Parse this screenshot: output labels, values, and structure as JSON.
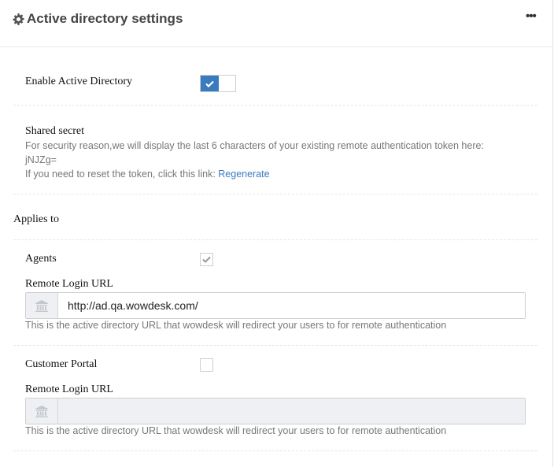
{
  "header": {
    "title": "Active directory settings",
    "menu_label": "•••"
  },
  "enable": {
    "label": "Enable Active Directory",
    "enabled": true
  },
  "shared_secret": {
    "label": "Shared secret",
    "description": "For security reason,we will display the last 6 characters of your existing remote authentication token here:",
    "token": "jNJZg=",
    "reset_text": "If you need to reset the token, click this link: ",
    "reset_link": "Regenerate"
  },
  "applies_to": {
    "label": "Applies to"
  },
  "agents": {
    "label": "Agents",
    "checked": true,
    "url_label": "Remote Login URL",
    "url_value": "http://ad.qa.wowdesk.com/",
    "help": "This is the active directory URL that wowdesk will redirect your users to for remote authentication"
  },
  "customer_portal": {
    "label": "Customer Portal",
    "checked": false,
    "url_label": "Remote Login URL",
    "url_value": "",
    "help": "This is the active directory URL that wowdesk will redirect your users to for remote authentication"
  }
}
